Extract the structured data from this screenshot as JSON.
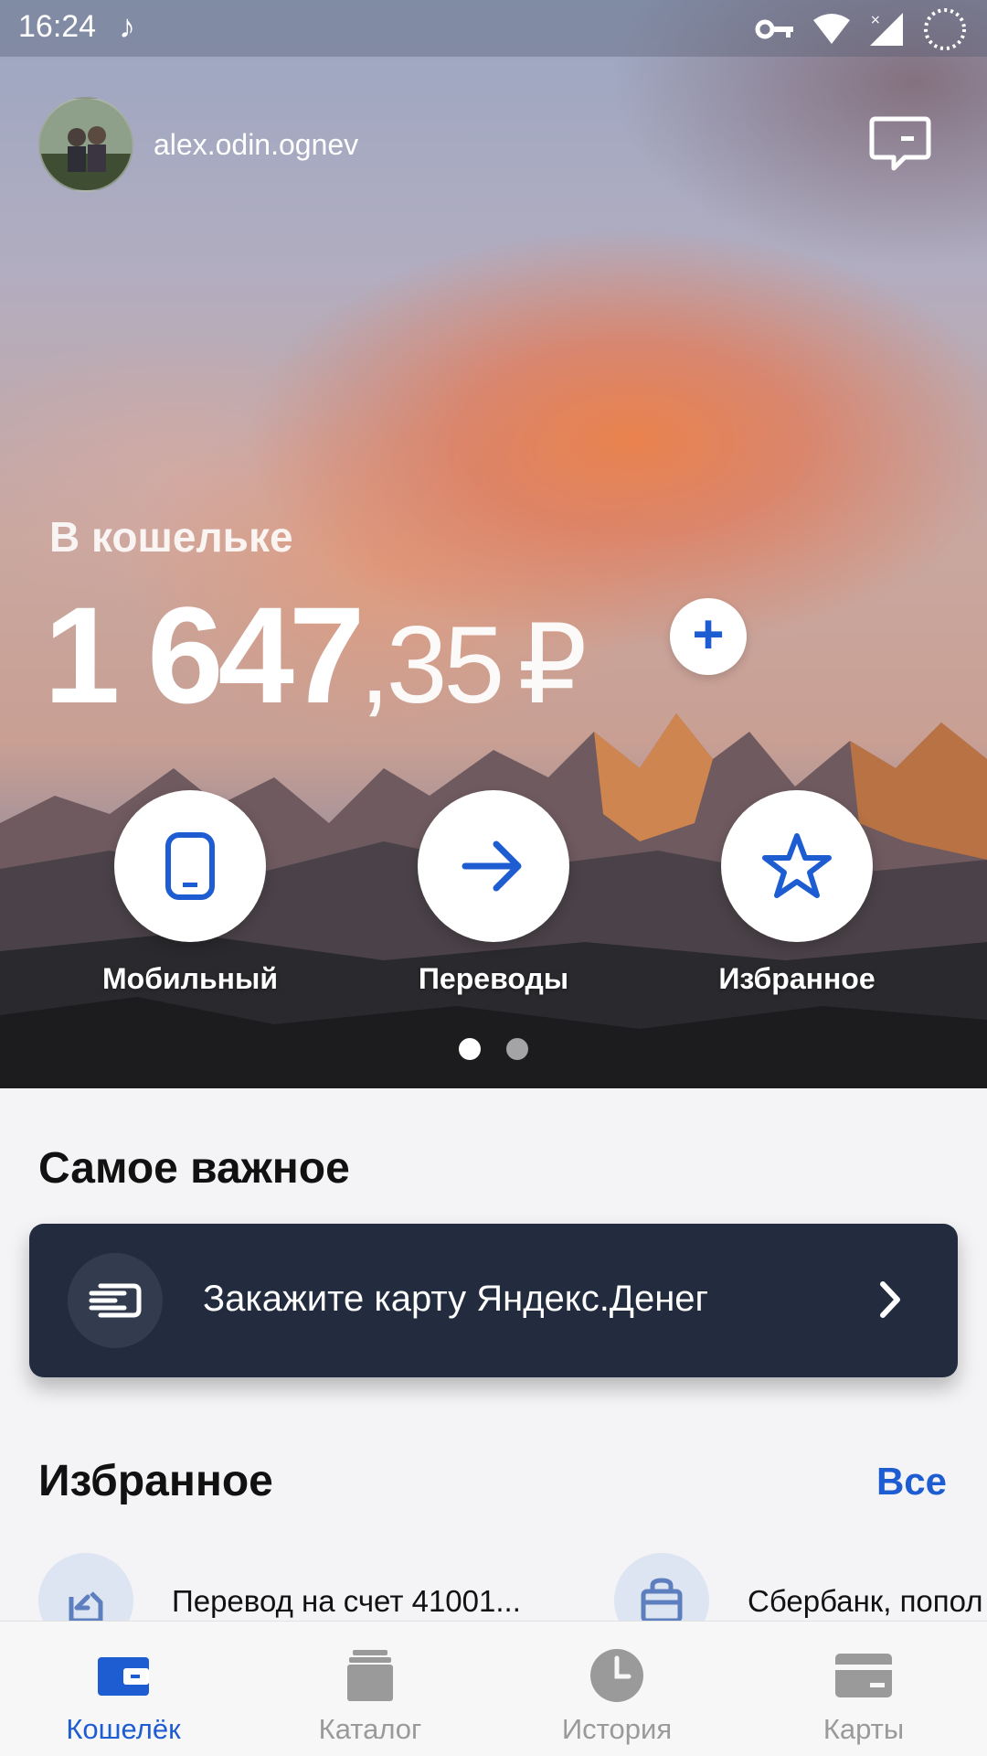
{
  "status_bar": {
    "time": "16:24",
    "icons": [
      "music-app-icon",
      "vpn-key-icon",
      "wifi-icon",
      "signal-icon",
      "loading-icon"
    ]
  },
  "header": {
    "username": "alex.odin.ognev",
    "avatar_icon": "user-photo-avatar",
    "chat_icon": "chat-bubble-icon"
  },
  "wallet": {
    "label": "В кошельке",
    "balance_int": "1 647",
    "balance_frac": ",35",
    "currency": "₽",
    "add_label": "+"
  },
  "actions": [
    {
      "label": "Мобильный",
      "icon": "phone-icon"
    },
    {
      "label": "Переводы",
      "icon": "arrow-right-icon"
    },
    {
      "label": "Избранное",
      "icon": "star-icon"
    }
  ],
  "pager": {
    "count": 2,
    "active": 0
  },
  "important": {
    "title": "Самое важное",
    "promo_text": "Закажите карту Яндекс.Денег",
    "promo_icon": "card-icon"
  },
  "favorites": {
    "title": "Избранное",
    "all_label": "Все",
    "items": [
      {
        "label": "Перевод на счет 41001...",
        "icon": "transfer-icon"
      },
      {
        "label": "Сбербанк, попол",
        "icon": "shopping-bag-icon"
      }
    ]
  },
  "tabs": [
    {
      "label": "Кошелёк",
      "icon": "wallet-icon",
      "active": true
    },
    {
      "label": "Каталог",
      "icon": "catalog-icon",
      "active": false
    },
    {
      "label": "История",
      "icon": "clock-icon",
      "active": false
    },
    {
      "label": "Карты",
      "icon": "card-icon",
      "active": false
    }
  ],
  "colors": {
    "accent": "#1e5dd1",
    "promo_bg": "#222c3e",
    "tab_inactive": "#9a9a9a"
  }
}
